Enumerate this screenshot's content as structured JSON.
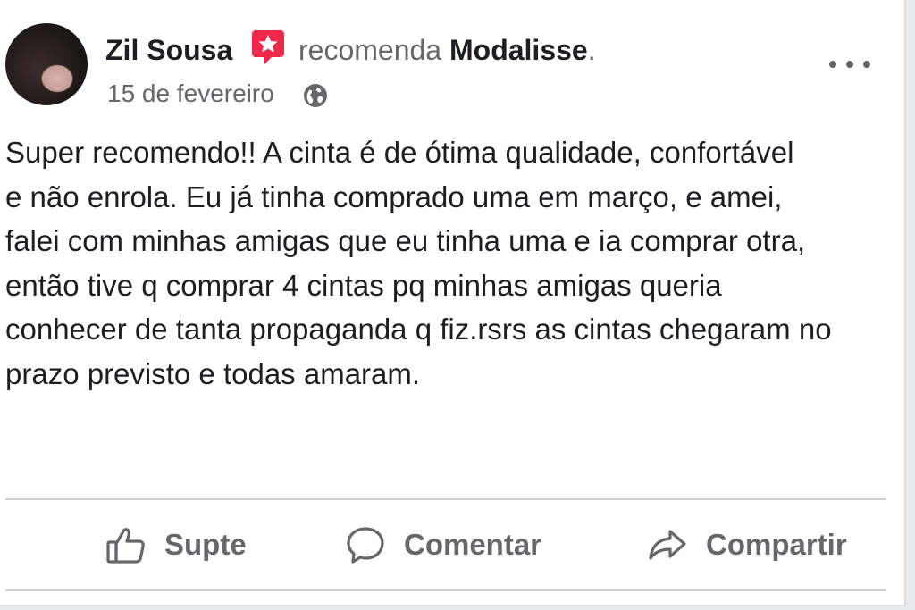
{
  "post": {
    "author": "Zil Sousa",
    "recommends_word": "recomenda",
    "page_name": "Modalisse",
    "page_suffix": ".",
    "date": "15 de fevereiro",
    "text": "Super recomendo!! A cinta é de ótima qualidade, confortável\ne não enrola. Eu já tinha comprado uma em março, e amei,\nfalei com minhas amigas que eu tinha uma e ia comprar otra,\nentão tive q comprar 4 cintas pq minhas amigas queria\nconhecer de tanta propaganda q fiz.rsrs as cintas chegaram no\nprazo previsto e todas amaram."
  },
  "actions": {
    "like_label": "Supte",
    "comment_label": "Comentar",
    "share_label": "Compartir"
  },
  "icons": {
    "recommend": "recommend-star-icon",
    "audience": "globe-icon",
    "menu": "more-options-icon",
    "like": "thumbs-up-icon",
    "comment": "comment-bubble-icon",
    "share": "share-arrow-icon"
  },
  "colors": {
    "recommend_badge": "#f02849",
    "secondary_text": "#65676b",
    "primary_text": "#1c1e21",
    "divider": "#cfd1d5"
  }
}
